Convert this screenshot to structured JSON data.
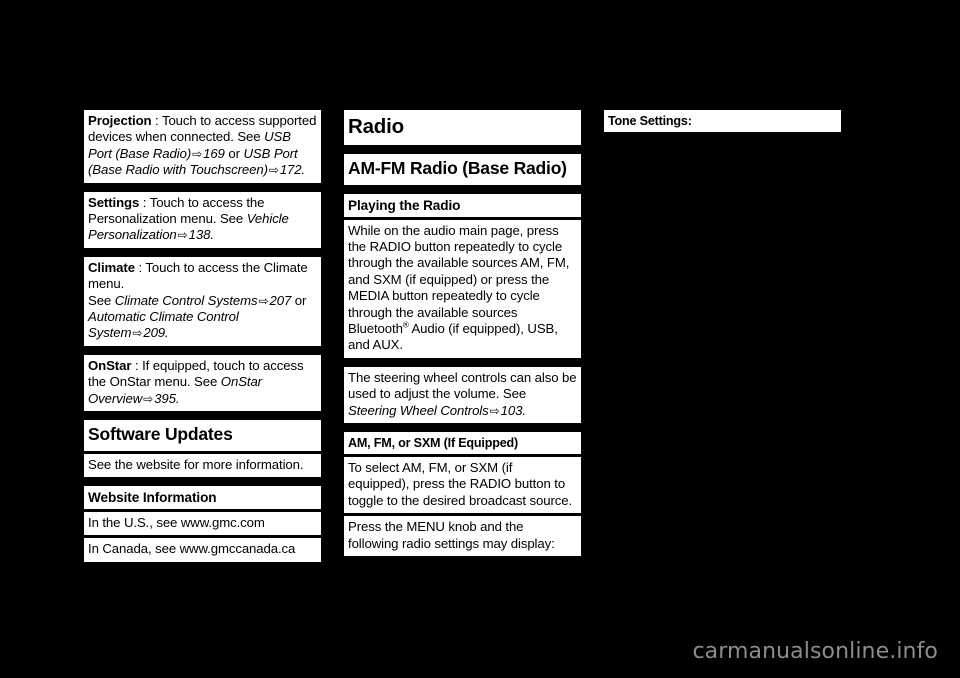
{
  "page": {
    "background_color": "#000000",
    "text_block_color": "#ffffff",
    "text_color": "#000000",
    "watermark": "carmanualsonline.info",
    "watermark_color": "#8c8c8c",
    "reference_arrow": "⇨"
  },
  "left_column": {
    "projection": {
      "term": "Projection",
      "separator": " : ",
      "text_1": "Touch to access supported devices when connected. See ",
      "ref_1": "USB Port (Base Radio)",
      "page_1": "169",
      "text_2": " or ",
      "ref_2": "USB Port (Base Radio with Touchscreen)",
      "page_2": "172",
      "tail": "."
    },
    "settings": {
      "term": "Settings",
      "separator": " : ",
      "text_1": "Touch to access the Personalization menu. See ",
      "ref_1": "Vehicle Personalization",
      "page_1": "138",
      "tail": "."
    },
    "climate": {
      "term": "Climate",
      "separator": " : ",
      "text_1": "Touch to access the Climate menu.",
      "text_2": "See ",
      "ref_1": "Climate Control Systems",
      "page_1": "207",
      "text_3": " or ",
      "ref_2": "Automatic Climate Control System",
      "page_2": "209",
      "tail": "."
    },
    "onstar": {
      "term": "OnStar",
      "separator": " : ",
      "text_1": "If equipped, touch to access the OnStar menu. See ",
      "ref_1": "OnStar Overview",
      "page_1": "395",
      "tail": "."
    },
    "software_updates_heading": "Software Updates",
    "software_updates_body": "See the website for more information.",
    "website_information_heading": "Website Information",
    "website_us": "In the U.S., see www.gmc.com",
    "website_canada": "In Canada, see www.gmccanada.ca"
  },
  "middle_column": {
    "radio_heading": "Radio",
    "am_fm_radio_heading": "AM-FM Radio (Base Radio)",
    "playing_the_radio_heading": "Playing the Radio",
    "playing_the_radio_body_part1": "While on the audio main page, press the RADIO button repeatedly to cycle through the available sources AM, FM, and SXM (if equipped) or press the MEDIA button repeatedly to cycle through the available sources Bluetooth",
    "playing_the_radio_superscript": "®",
    "playing_the_radio_body_part2": " Audio (if equipped), USB, and AUX.",
    "steering_wheel_text": "The steering wheel controls can also be used to adjust the volume. See ",
    "steering_wheel_ref": "Steering Wheel Controls",
    "steering_wheel_page": "103",
    "steering_wheel_tail": ".",
    "am_fm_sxm_heading": "AM, FM, or SXM (If Equipped)",
    "am_fm_sxm_body": "To select AM, FM, or SXM (if equipped), press the RADIO button to toggle to the desired broadcast source.",
    "menu_knob_body": "Press the MENU knob and the following radio settings may display:"
  },
  "right_column": {
    "tone_settings_heading": "Tone Settings:"
  }
}
